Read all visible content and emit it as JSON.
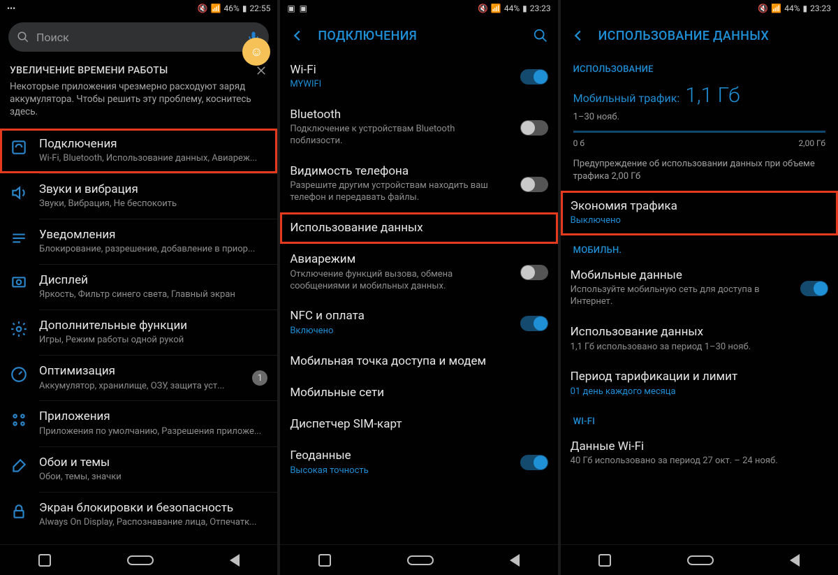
{
  "screen1": {
    "status": {
      "battery": "46%",
      "time": "22:55"
    },
    "search_placeholder": "Поиск",
    "banner": {
      "title": "УВЕЛИЧЕНИЕ ВРЕМЕНИ РАБОТЫ",
      "body": "Некоторые приложения чрезмерно расходуют заряд аккумулятора. Чтобы решить эту проблему, коснитесь здесь."
    },
    "items": [
      {
        "title": "Подключения",
        "sub": "Wi-Fi, Bluetooth, Использование данных, Авиареж..."
      },
      {
        "title": "Звуки и вибрация",
        "sub": "Звуки, Вибрация, Не беспокоить"
      },
      {
        "title": "Уведомления",
        "sub": "Блокирование, разрешение, добавление в приор..."
      },
      {
        "title": "Дисплей",
        "sub": "Яркость, Фильтр синего света, Главный экран"
      },
      {
        "title": "Дополнительные функции",
        "sub": "Игры, Режим работы одной рукой"
      },
      {
        "title": "Оптимизация",
        "sub": "Аккумулятор, хранилище, ОЗУ, защита уст...",
        "badge": "1"
      },
      {
        "title": "Приложения",
        "sub": "Приложения по умолчанию, Разрешения приложе..."
      },
      {
        "title": "Обои и темы",
        "sub": "Обои, темы, значки"
      },
      {
        "title": "Экран блокировки и безопасность",
        "sub": "Always On Display, Распознавание лица, Отпечатк..."
      }
    ]
  },
  "screen2": {
    "status": {
      "battery": "44%",
      "time": "23:23"
    },
    "header": "ПОДКЛЮЧЕНИЯ",
    "items": [
      {
        "title": "Wi-Fi",
        "sub": "MYWIFI",
        "sub_accent": true,
        "toggle": "on"
      },
      {
        "title": "Bluetooth",
        "sub": "Подключение к устройствам Bluetooth поблизости.",
        "toggle": "off"
      },
      {
        "title": "Видимость телефона",
        "sub": "Разрешите другим устройствам находить ваш телефон и передавать файлы.",
        "toggle": "off"
      },
      {
        "title": "Использование данных"
      },
      {
        "title": "Авиарежим",
        "sub": "Отключение функций вызова, обмена сообщениями и мобильных данных.",
        "toggle": "off"
      },
      {
        "title": "NFC и оплата",
        "sub": "Включено",
        "sub_accent": true,
        "toggle": "on"
      },
      {
        "title": "Мобильная точка доступа и модем"
      },
      {
        "title": "Мобильные сети"
      },
      {
        "title": "Диспетчер SIM-карт"
      },
      {
        "title": "Геоданные",
        "sub": "Высокая точность",
        "sub_accent": true,
        "toggle": "on"
      }
    ]
  },
  "screen3": {
    "status": {
      "battery": "44%",
      "time": "23:23"
    },
    "header": "ИСПОЛЬЗОВАНИЕ ДАННЫХ",
    "section_usage": "ИСПОЛЬЗОВАНИЕ",
    "usage": {
      "label": "Мобильный трафик:",
      "value": "1,1 Гб",
      "period": "1–30 нояб.",
      "scale_min": "0 б",
      "scale_max": "2,00 Гб",
      "warning": "Предупреждение об использовании данных при объеме трафика 2,00 Гб"
    },
    "saver": {
      "title": "Экономия трафика",
      "sub": "Выключено"
    },
    "section_mobile": "МОБИЛЬН.",
    "mobile_items": [
      {
        "title": "Мобильные данные",
        "sub": "Используйте мобильную сеть для доступа в Интернет.",
        "toggle": "on"
      },
      {
        "title": "Использование данных",
        "sub": "1,1 Гб использовано за период 1–30 нояб."
      },
      {
        "title": "Период тарификации и лимит",
        "sub": "01 день каждого месяца",
        "sub_accent": true
      }
    ],
    "section_wifi": "WI-FI",
    "wifi_items": [
      {
        "title": "Данные Wi-Fi",
        "sub": "40 Гб использовано за период 27 окт. – 24 нояб."
      }
    ]
  }
}
